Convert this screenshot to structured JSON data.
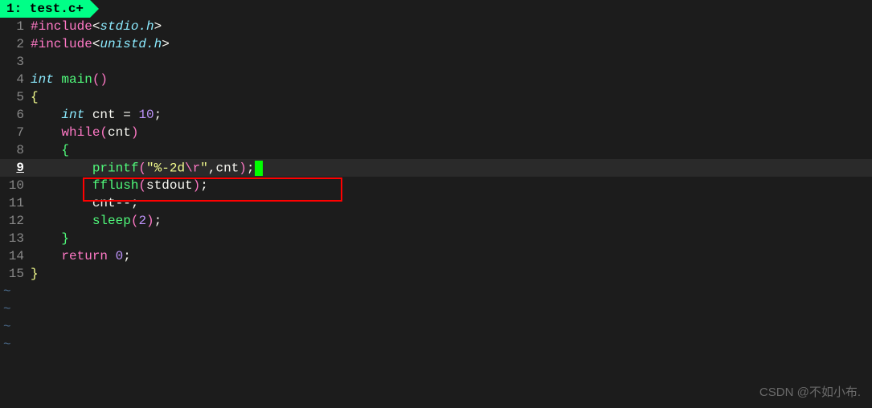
{
  "tab": {
    "label": " 1: test.c+ "
  },
  "lines": [
    {
      "n": "1",
      "seg": [
        [
          "kw",
          "#include"
        ],
        [
          "punct",
          "<"
        ],
        [
          "type",
          "stdio.h"
        ],
        [
          "punct",
          ">"
        ]
      ]
    },
    {
      "n": "2",
      "seg": [
        [
          "kw",
          "#include"
        ],
        [
          "punct",
          "<"
        ],
        [
          "type",
          "unistd.h"
        ],
        [
          "punct",
          ">"
        ]
      ]
    },
    {
      "n": "3",
      "seg": []
    },
    {
      "n": "4",
      "seg": [
        [
          "type",
          "int"
        ],
        [
          "var",
          " "
        ],
        [
          "fn",
          "main"
        ],
        [
          "paren1",
          "()"
        ]
      ]
    },
    {
      "n": "5",
      "seg": [
        [
          "brace1",
          "{"
        ]
      ]
    },
    {
      "n": "6",
      "seg": [
        [
          "var",
          "    "
        ],
        [
          "type",
          "int"
        ],
        [
          "var",
          " cnt "
        ],
        [
          "punct",
          "="
        ],
        [
          "var",
          " "
        ],
        [
          "num",
          "10"
        ],
        [
          "punct",
          ";"
        ]
      ]
    },
    {
      "n": "7",
      "seg": [
        [
          "var",
          "    "
        ],
        [
          "kw",
          "while"
        ],
        [
          "paren1",
          "("
        ],
        [
          "var",
          "cnt"
        ],
        [
          "paren1",
          ")"
        ]
      ]
    },
    {
      "n": "8",
      "seg": [
        [
          "var",
          "    "
        ],
        [
          "paren2",
          "{"
        ]
      ]
    },
    {
      "n": "9",
      "current": true,
      "seg": [
        [
          "var",
          "        "
        ],
        [
          "fn",
          "printf"
        ],
        [
          "paren1",
          "("
        ],
        [
          "str",
          "\"%-2d"
        ],
        [
          "esc",
          "\\r"
        ],
        [
          "str",
          "\""
        ],
        [
          "punct",
          ","
        ],
        [
          "var",
          "cnt"
        ],
        [
          "paren1",
          ")"
        ],
        [
          "punct",
          ";"
        ]
      ],
      "cursor": true
    },
    {
      "n": "10",
      "seg": [
        [
          "var",
          "        "
        ],
        [
          "fn",
          "fflush"
        ],
        [
          "paren1",
          "("
        ],
        [
          "var",
          "stdout"
        ],
        [
          "paren1",
          ")"
        ],
        [
          "punct",
          ";"
        ]
      ]
    },
    {
      "n": "11",
      "seg": [
        [
          "var",
          "        cnt"
        ],
        [
          "punct",
          "--;"
        ]
      ]
    },
    {
      "n": "12",
      "seg": [
        [
          "var",
          "        "
        ],
        [
          "fn",
          "sleep"
        ],
        [
          "paren1",
          "("
        ],
        [
          "num",
          "2"
        ],
        [
          "paren1",
          ")"
        ],
        [
          "punct",
          ";"
        ]
      ]
    },
    {
      "n": "13",
      "seg": [
        [
          "var",
          "    "
        ],
        [
          "paren2",
          "}"
        ]
      ]
    },
    {
      "n": "14",
      "seg": [
        [
          "var",
          "    "
        ],
        [
          "kw",
          "return"
        ],
        [
          "var",
          " "
        ],
        [
          "num",
          "0"
        ],
        [
          "punct",
          ";"
        ]
      ]
    },
    {
      "n": "15",
      "seg": [
        [
          "brace1",
          "}"
        ]
      ]
    }
  ],
  "tildes": [
    "~",
    "~",
    "~",
    "~"
  ],
  "watermark": "CSDN @不如小布."
}
